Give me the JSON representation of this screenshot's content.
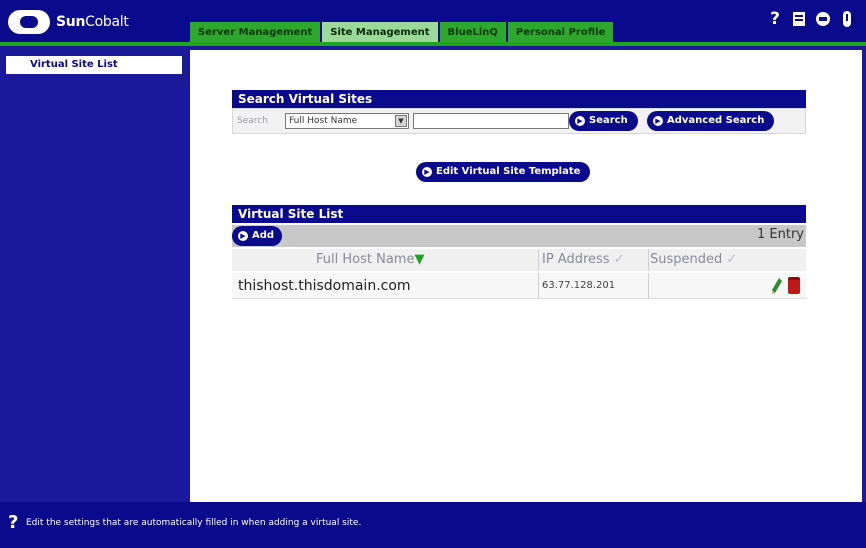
{
  "brand": {
    "logo_bold": "Sun",
    "logo_thin": "Cobalt"
  },
  "tabs": [
    {
      "label": "Server Management",
      "active": false
    },
    {
      "label": "Site Management",
      "active": true
    },
    {
      "label": "BlueLinQ",
      "active": false
    },
    {
      "label": "Personal Profile",
      "active": false
    }
  ],
  "top_icons": [
    "help-icon",
    "update-icon",
    "logout-icon",
    "power-icon"
  ],
  "sidebar": {
    "items": [
      {
        "label": "Virtual Site List",
        "selected": true
      }
    ]
  },
  "search": {
    "title": "Search Virtual Sites",
    "label": "Search",
    "field_selected": "Full Host Name",
    "query_value": "",
    "search_button": "Search",
    "advanced_button": "Advanced Search"
  },
  "template_button": "Edit Virtual Site Template",
  "site_list": {
    "title": "Virtual Site List",
    "add_button": "Add",
    "entry_count": "1 Entry",
    "columns": [
      "Full Host Name",
      "IP Address",
      "Suspended"
    ],
    "sort_arrow": "▼",
    "sortable_mark": "✓",
    "rows": [
      {
        "host": "thishost.thisdomain.com",
        "ip": "63.77.128.201",
        "suspended": ""
      }
    ]
  },
  "footer": {
    "help_text": "Edit the settings that are automatically filled in when adding a virtual site."
  },
  "colors": {
    "navy": "#0a0a8c",
    "green": "#2da82d",
    "active_tab": "#9ad99a"
  }
}
